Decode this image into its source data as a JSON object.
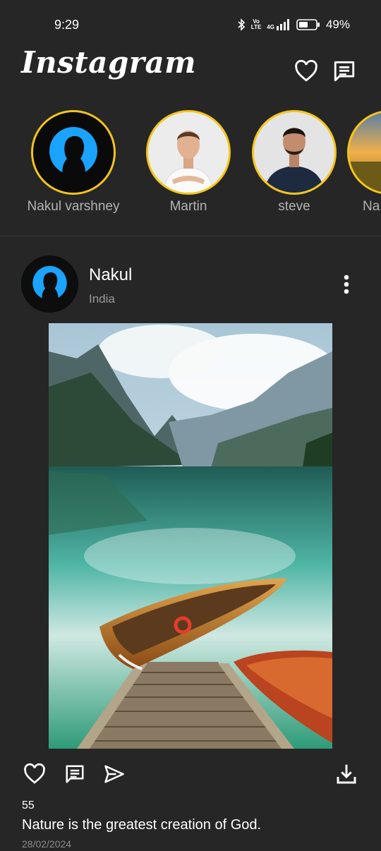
{
  "status_bar": {
    "time": "9:29",
    "battery": "49%",
    "volte_top": "Vo",
    "volte_bottom": "LTE",
    "network": "4G",
    "icons": [
      "bluetooth-icon",
      "volte-icon",
      "signal-icon",
      "battery-icon"
    ]
  },
  "header": {
    "logo": "Instagram",
    "icons": [
      "heart-icon",
      "messages-icon"
    ]
  },
  "stories": [
    {
      "name": "Nakul varshney",
      "avatar": "silhouette-avatar"
    },
    {
      "name": "Martin",
      "avatar": "man-white-shirt-photo"
    },
    {
      "name": "steve",
      "avatar": "man-navy-sweater-photo"
    },
    {
      "name": "Na",
      "avatar": "sunset-field-photo"
    }
  ],
  "post": {
    "username": "Nakul",
    "location": "India",
    "image": "mountain-lake-boats-photo",
    "likes": "55",
    "caption": "Nature is the greatest creation of God.",
    "date": "28/02/2024",
    "action_icons": [
      "like-icon",
      "comment-icon",
      "share-icon",
      "download-icon"
    ]
  },
  "colors": {
    "background": "#262626",
    "story_ring": "#f5c518",
    "avatar_accent": "#1aa3ff",
    "secondary_text": "#9a9a9a"
  }
}
